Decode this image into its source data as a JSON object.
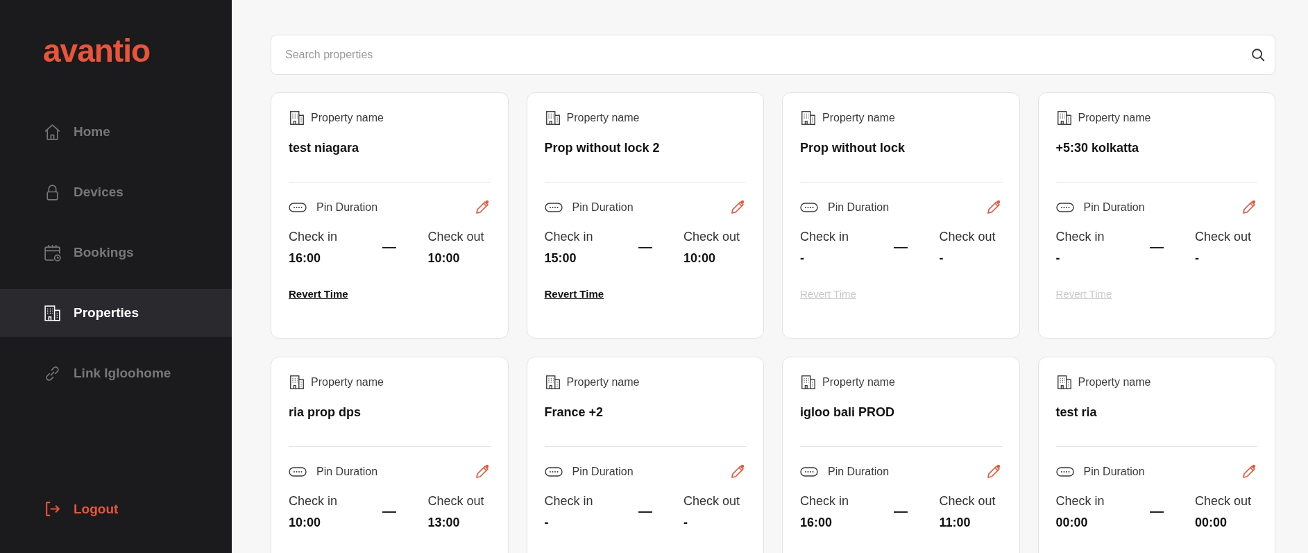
{
  "sidebar": {
    "logo": "avantio",
    "items": [
      {
        "label": "Home",
        "selected": false
      },
      {
        "label": "Devices",
        "selected": false
      },
      {
        "label": "Bookings",
        "selected": false
      },
      {
        "label": "Properties",
        "selected": true
      },
      {
        "label": "Link Igloohome",
        "selected": false
      }
    ],
    "logout": "Logout"
  },
  "search": {
    "placeholder": "Search properties"
  },
  "cards": [
    {
      "property_label": "Property name",
      "name": "test niagara",
      "pin_label": "Pin Duration",
      "check_in_label": "Check in",
      "check_in": "16:00",
      "check_out_label": "Check out",
      "check_out": "10:00",
      "revert": {
        "label": "Revert Time",
        "disabled": false
      }
    },
    {
      "property_label": "Property name",
      "name": "Prop without lock 2",
      "pin_label": "Pin Duration",
      "check_in_label": "Check in",
      "check_in": "15:00",
      "check_out_label": "Check out",
      "check_out": "10:00",
      "revert": {
        "label": "Revert Time",
        "disabled": false
      }
    },
    {
      "property_label": "Property name",
      "name": "Prop without lock",
      "pin_label": "Pin Duration",
      "check_in_label": "Check in",
      "check_in": "-",
      "check_out_label": "Check out",
      "check_out": "-",
      "revert": {
        "label": "Revert Time",
        "disabled": true
      }
    },
    {
      "property_label": "Property name",
      "name": "+5:30 kolkatta",
      "pin_label": "Pin Duration",
      "check_in_label": "Check in",
      "check_in": "-",
      "check_out_label": "Check out",
      "check_out": "-",
      "revert": {
        "label": "Revert Time",
        "disabled": true
      }
    },
    {
      "property_label": "Property name",
      "name": "ria prop dps",
      "pin_label": "Pin Duration",
      "check_in_label": "Check in",
      "check_in": "10:00",
      "check_out_label": "Check out",
      "check_out": "13:00"
    },
    {
      "property_label": "Property name",
      "name": "France +2",
      "pin_label": "Pin Duration",
      "check_in_label": "Check in",
      "check_in": "-",
      "check_out_label": "Check out",
      "check_out": "-"
    },
    {
      "property_label": "Property name",
      "name": "igloo bali PROD",
      "pin_label": "Pin Duration",
      "check_in_label": "Check in",
      "check_in": "16:00",
      "check_out_label": "Check out",
      "check_out": "11:00"
    },
    {
      "property_label": "Property name",
      "name": "test ria",
      "pin_label": "Pin Duration",
      "check_in_label": "Check in",
      "check_in": "00:00",
      "check_out_label": "Check out",
      "check_out": "00:00"
    }
  ]
}
